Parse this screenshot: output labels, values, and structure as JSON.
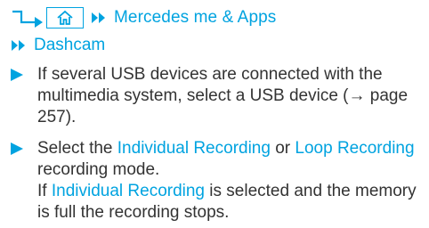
{
  "breadcrumb": {
    "level1": "Mercedes me & Apps",
    "level2": "Dashcam"
  },
  "steps": [
    {
      "text_before": "If several USB devices are connected with the multimedia system, select a USB device (",
      "page_ref": "→ page 257",
      "text_after": ")."
    },
    {
      "text1": "Select the ",
      "link1": "Individual Recording",
      "text2": " or ",
      "link2": "Loop Recording",
      "text3": " recording mode.",
      "text4": "If ",
      "link3": "Individual Recording",
      "text5": " is selected and the memory is full the recording stops."
    }
  ],
  "colors": {
    "accent": "#00a3e0",
    "text": "#333333"
  },
  "icons": {
    "nav_arrow": "turn-right-arrow-icon",
    "home": "home-icon",
    "next": "double-chevron-right-icon",
    "bullet": "triangle-bullet-icon"
  }
}
